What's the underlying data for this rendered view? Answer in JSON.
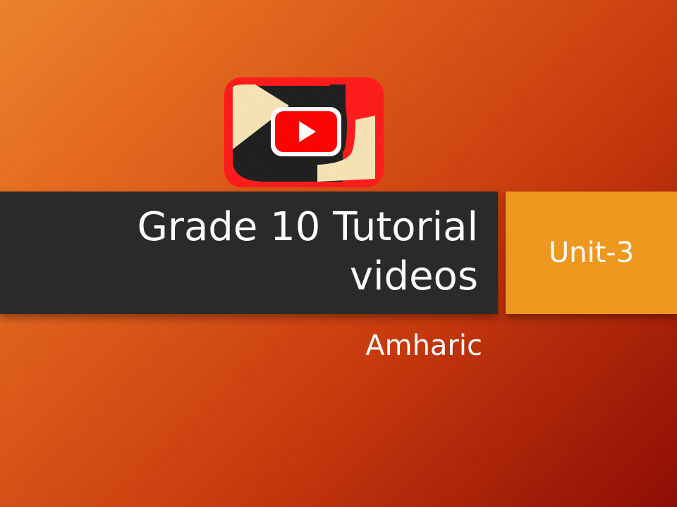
{
  "slide": {
    "title": "Grade 10 Tutorial videos",
    "unit_label": "Unit-3",
    "subtitle": "Amharic"
  },
  "logo": {
    "icon": "youtube-studio-icon",
    "colors": {
      "frame": "#ff1a1a",
      "dark": "#1e1e1e",
      "cream": "#f7e4b4",
      "play_button": "#ff0000",
      "play_triangle": "#ffffff"
    }
  },
  "colors": {
    "background_start": "#ef8229",
    "background_end": "#8f0b02",
    "title_band": "#282828",
    "unit_box": "#f0981d",
    "text": "#ffffff"
  }
}
